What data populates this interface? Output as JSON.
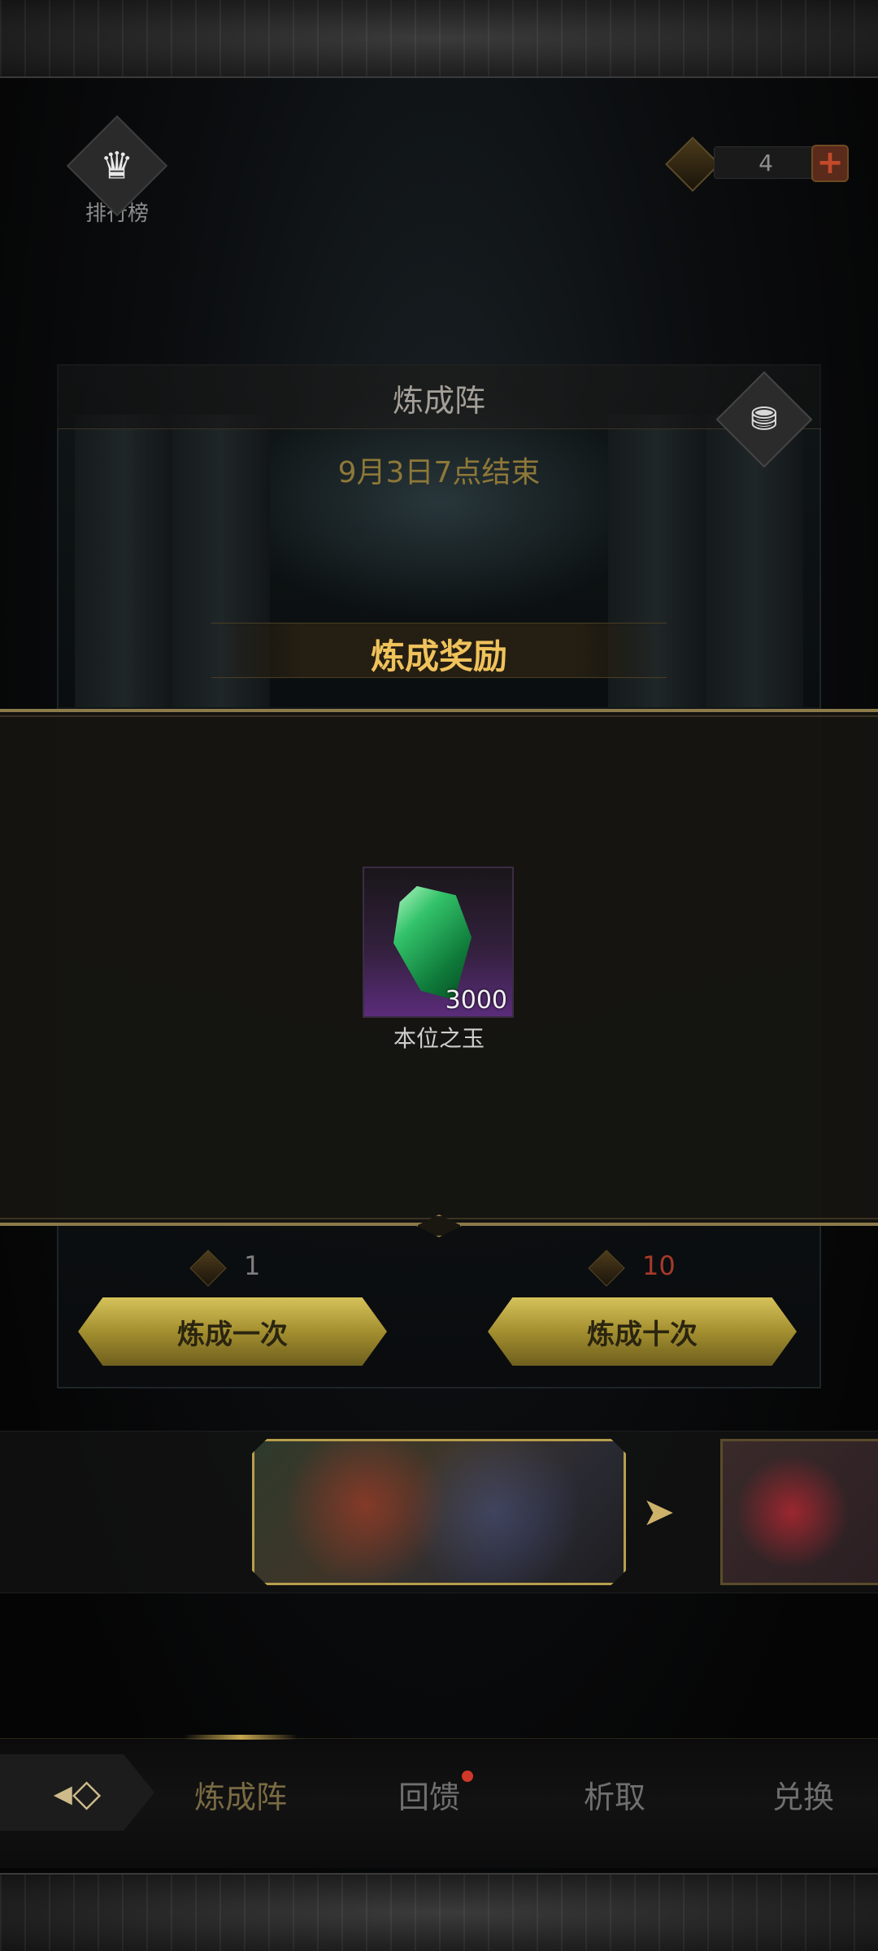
{
  "header": {
    "ranking_label": "排行榜",
    "currency_amount": "4"
  },
  "panel": {
    "title": "炼成阵",
    "end_time": "9月3日7点结束",
    "reward_title": "炼成奖励"
  },
  "reward": {
    "item_name": "本位之玉",
    "quantity": "3000"
  },
  "actions": {
    "once_cost": "1",
    "ten_cost": "10",
    "once_label": "炼成一次",
    "ten_label": "炼成十次"
  },
  "nav": {
    "tabs": [
      {
        "label": "炼成阵",
        "active": true
      },
      {
        "label": "回馈",
        "badge": true
      },
      {
        "label": "析取"
      },
      {
        "label": "兑换"
      }
    ]
  },
  "colors": {
    "accent_gold": "#efc25b",
    "button_gold": "#d6c25a",
    "cost_red": "#a63a2a",
    "badge_red": "#d0382a"
  }
}
